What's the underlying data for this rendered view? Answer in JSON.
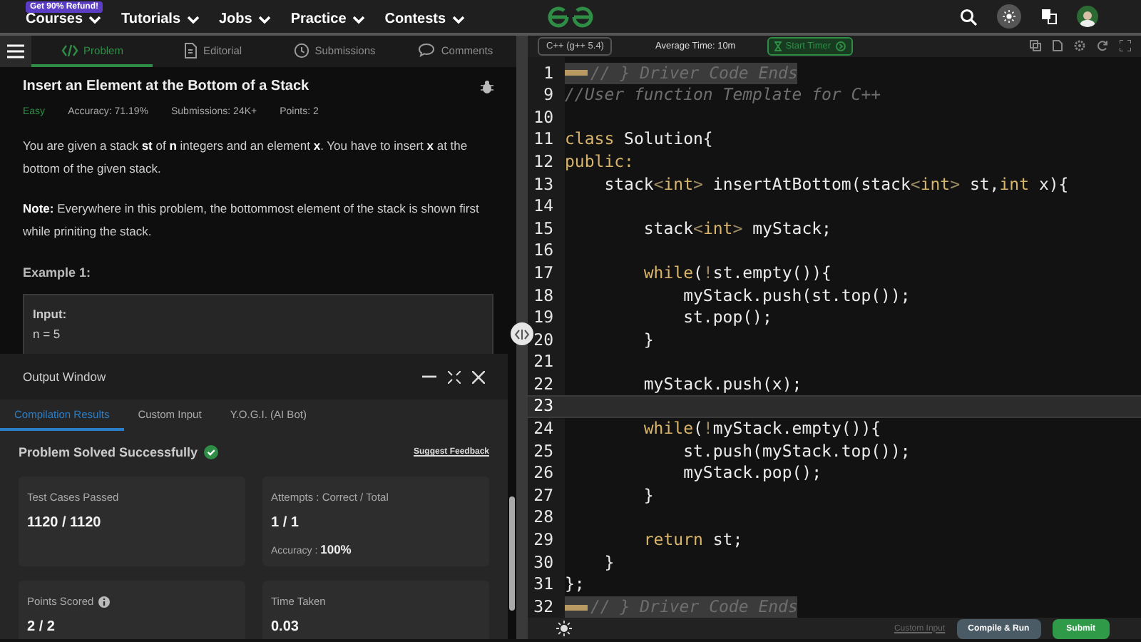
{
  "nav": {
    "promo": "Get 90% Refund!",
    "menu": [
      {
        "label": "Courses"
      },
      {
        "label": "Tutorials"
      },
      {
        "label": "Jobs"
      },
      {
        "label": "Practice"
      },
      {
        "label": "Contests"
      }
    ]
  },
  "problem_tabs": [
    {
      "label": "Problem",
      "selected": true
    },
    {
      "label": "Editorial",
      "selected": false
    },
    {
      "label": "Submissions",
      "selected": false
    },
    {
      "label": "Comments",
      "selected": false
    }
  ],
  "problem": {
    "title": "Insert an Element at the Bottom of a Stack",
    "difficulty": "Easy",
    "accuracy": "Accuracy: 71.19%",
    "submissions": "Submissions: 24K+",
    "points": "Points: 2",
    "paragraphs": [
      "You are given a stack **st** of **n** integers and an element **x**. You have to insert **x** at the bottom of the given stack.",
      "**Note:** Everywhere in this problem, the bottommost element of the stack is shown first while priniting the stack."
    ],
    "example_title": "Example 1:",
    "example_lines": [
      "Input:",
      "n = 5"
    ]
  },
  "output_window": {
    "title": "Output Window",
    "tabs": [
      {
        "label": "Compilation Results",
        "selected": true
      },
      {
        "label": "Custom Input",
        "selected": false
      },
      {
        "label": "Y.O.G.I. (AI Bot)",
        "selected": false
      }
    ],
    "status": "Problem Solved Successfully",
    "feedback": "Suggest Feedback",
    "cards": [
      {
        "label": "Test Cases Passed",
        "value": "1120 / 1120",
        "info": false
      },
      {
        "label": "Attempts : Correct / Total",
        "value": "1 / 1",
        "sub_label": "Accuracy : ",
        "sub_value": "100%",
        "info": false
      },
      {
        "label": "Points Scored",
        "value": "2 / 2",
        "info": true
      },
      {
        "label": "Time Taken",
        "value": "0.03",
        "info": false
      }
    ]
  },
  "editor": {
    "language": "C++ (g++ 5.4)",
    "average_time": "Average Time: 10m",
    "timer": "Start Timer",
    "lines": [
      {
        "number": "1",
        "kind": "folded",
        "current": false,
        "tokens": [
          {
            "kind": "comment",
            "text": "// } Driver Code Ends"
          }
        ]
      },
      {
        "number": "9",
        "kind": "code",
        "current": false,
        "tokens": [
          {
            "kind": "comment",
            "text": "//User function Template for C++"
          }
        ]
      },
      {
        "number": "10",
        "kind": "blank",
        "current": false
      },
      {
        "number": "11",
        "kind": "code",
        "current": false,
        "tokens": [
          {
            "kind": "keyword",
            "text": "class"
          },
          {
            "kind": "plain",
            "text": " Solution{"
          }
        ]
      },
      {
        "number": "12",
        "kind": "code",
        "current": false,
        "tokens": [
          {
            "kind": "keyword",
            "text": "public:"
          }
        ]
      },
      {
        "number": "13",
        "kind": "code",
        "current": false,
        "tokens": [
          {
            "kind": "plain",
            "text": "    stack"
          },
          {
            "kind": "punct",
            "text": "<"
          },
          {
            "kind": "keyword",
            "text": "int"
          },
          {
            "kind": "punct",
            "text": ">"
          },
          {
            "kind": "plain",
            "text": " insertAtBottom(stack"
          },
          {
            "kind": "punct",
            "text": "<"
          },
          {
            "kind": "keyword",
            "text": "int"
          },
          {
            "kind": "punct",
            "text": ">"
          },
          {
            "kind": "plain",
            "text": " st,"
          },
          {
            "kind": "keyword",
            "text": "int"
          },
          {
            "kind": "plain",
            "text": " x){"
          }
        ]
      },
      {
        "number": "14",
        "kind": "blank",
        "current": false
      },
      {
        "number": "15",
        "kind": "code",
        "current": false,
        "tokens": [
          {
            "kind": "plain",
            "text": "        stack"
          },
          {
            "kind": "punct",
            "text": "<"
          },
          {
            "kind": "keyword",
            "text": "int"
          },
          {
            "kind": "punct",
            "text": ">"
          },
          {
            "kind": "plain",
            "text": " myStack;"
          }
        ]
      },
      {
        "number": "16",
        "kind": "blank",
        "current": false
      },
      {
        "number": "17",
        "kind": "code",
        "current": false,
        "tokens": [
          {
            "kind": "keyword",
            "text": "        while"
          },
          {
            "kind": "plain",
            "text": "("
          },
          {
            "kind": "punct",
            "text": "!"
          },
          {
            "kind": "plain",
            "text": "st.empty()){"
          }
        ]
      },
      {
        "number": "18",
        "kind": "code",
        "current": false,
        "tokens": [
          {
            "kind": "plain",
            "text": "            myStack.push(st.top());"
          }
        ]
      },
      {
        "number": "19",
        "kind": "code",
        "current": false,
        "tokens": [
          {
            "kind": "plain",
            "text": "            st.pop();"
          }
        ]
      },
      {
        "number": "20",
        "kind": "code",
        "current": false,
        "tokens": [
          {
            "kind": "plain",
            "text": "        }"
          }
        ]
      },
      {
        "number": "21",
        "kind": "blank",
        "current": false
      },
      {
        "number": "22",
        "kind": "code",
        "current": false,
        "tokens": [
          {
            "kind": "plain",
            "text": "        myStack.push(x);"
          }
        ]
      },
      {
        "number": "23",
        "kind": "blank",
        "current": true
      },
      {
        "number": "24",
        "kind": "code",
        "current": false,
        "tokens": [
          {
            "kind": "keyword",
            "text": "        while"
          },
          {
            "kind": "plain",
            "text": "("
          },
          {
            "kind": "punct",
            "text": "!"
          },
          {
            "kind": "plain",
            "text": "myStack.empty()){"
          }
        ]
      },
      {
        "number": "25",
        "kind": "code",
        "current": false,
        "tokens": [
          {
            "kind": "plain",
            "text": "            st.push(myStack.top());"
          }
        ]
      },
      {
        "number": "26",
        "kind": "code",
        "current": false,
        "tokens": [
          {
            "kind": "plain",
            "text": "            myStack.pop();"
          }
        ]
      },
      {
        "number": "27",
        "kind": "code",
        "current": false,
        "tokens": [
          {
            "kind": "plain",
            "text": "        }"
          }
        ]
      },
      {
        "number": "28",
        "kind": "blank",
        "current": false
      },
      {
        "number": "29",
        "kind": "code",
        "current": false,
        "tokens": [
          {
            "kind": "keyword",
            "text": "        return"
          },
          {
            "kind": "plain",
            "text": " st;"
          }
        ]
      },
      {
        "number": "30",
        "kind": "code",
        "current": false,
        "tokens": [
          {
            "kind": "plain",
            "text": "    }"
          }
        ]
      },
      {
        "number": "31",
        "kind": "code",
        "current": false,
        "tokens": [
          {
            "kind": "plain",
            "text": "};"
          }
        ]
      },
      {
        "number": "32",
        "kind": "folded",
        "current": false,
        "tokens": [
          {
            "kind": "comment",
            "text": "// } Driver Code Ends"
          }
        ]
      }
    ],
    "footer": {
      "custom_input": "Custom Input",
      "compile": "Compile & Run",
      "submit": "Submit"
    }
  }
}
